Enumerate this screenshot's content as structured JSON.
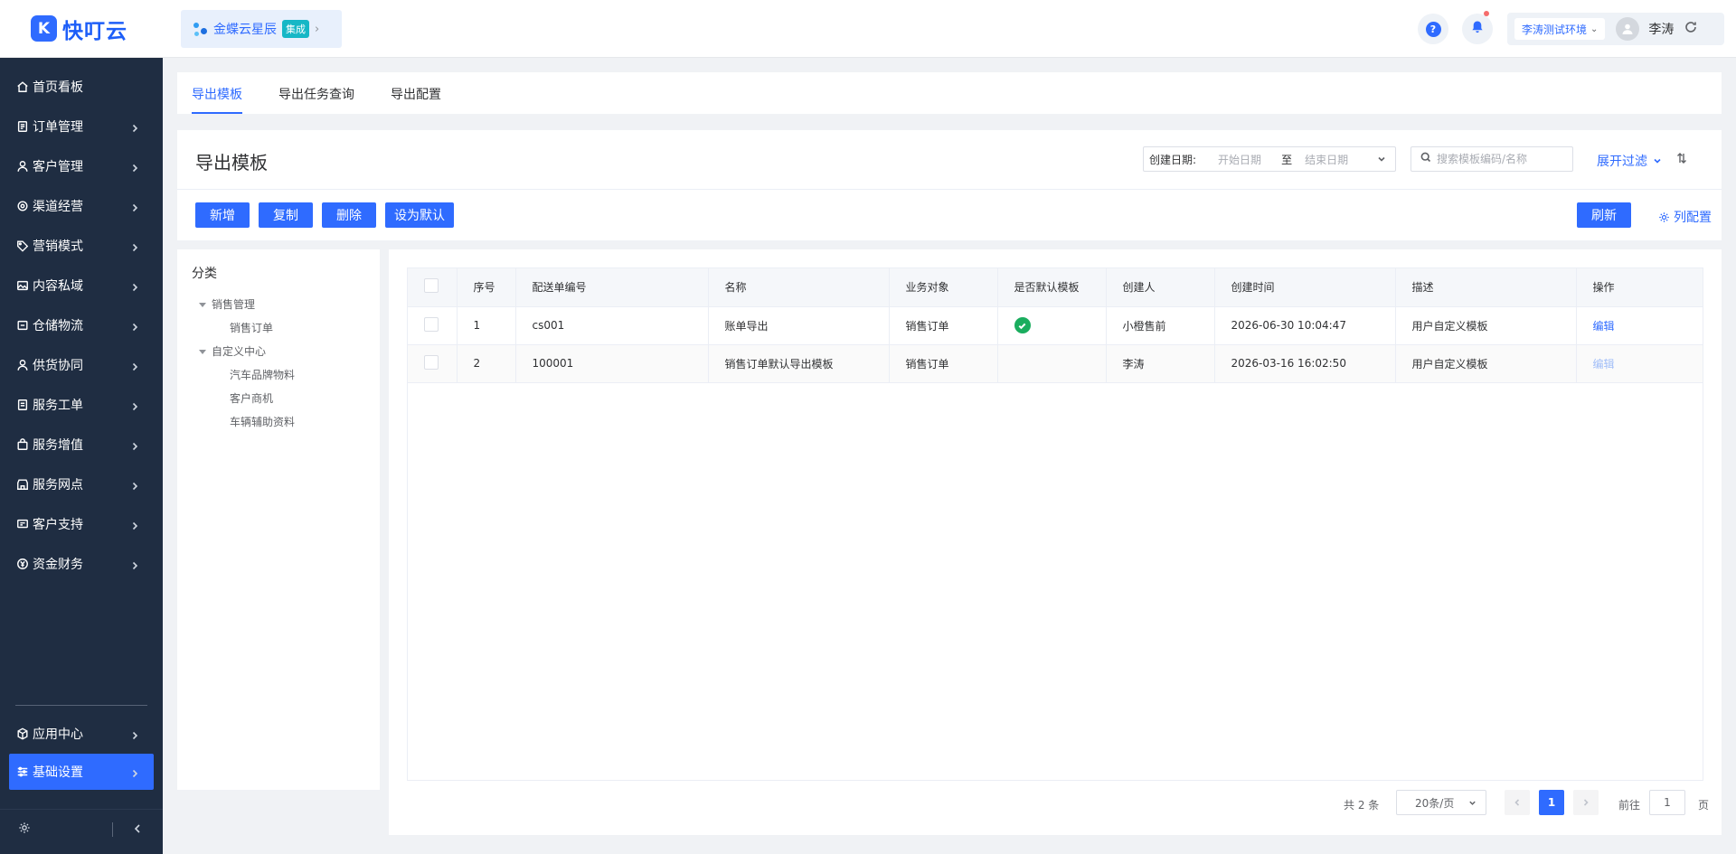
{
  "logo": {
    "text": "快叮云"
  },
  "sidebar": {
    "items": [
      {
        "label": "首页看板",
        "icon": "home-icon",
        "has_children": false
      },
      {
        "label": "订单管理",
        "icon": "order-icon",
        "has_children": true
      },
      {
        "label": "客户管理",
        "icon": "customer-icon",
        "has_children": true
      },
      {
        "label": "渠道经营",
        "icon": "channel-icon",
        "has_children": true
      },
      {
        "label": "营销模式",
        "icon": "tag-icon",
        "has_children": true
      },
      {
        "label": "内容私域",
        "icon": "image-icon",
        "has_children": true
      },
      {
        "label": "仓储物流",
        "icon": "warehouse-icon",
        "has_children": true
      },
      {
        "label": "供货协同",
        "icon": "supply-icon",
        "has_children": true
      },
      {
        "label": "服务工单",
        "icon": "ticket-icon",
        "has_children": true
      },
      {
        "label": "服务增值",
        "icon": "bag-icon",
        "has_children": true
      },
      {
        "label": "服务网点",
        "icon": "store-icon",
        "has_children": true
      },
      {
        "label": "客户支持",
        "icon": "support-icon",
        "has_children": true
      },
      {
        "label": "资金财务",
        "icon": "yen-icon",
        "has_children": true
      }
    ],
    "bottom_items": [
      {
        "label": "应用中心",
        "icon": "cube-icon",
        "active": false
      },
      {
        "label": "基础设置",
        "icon": "settings-sliders-icon",
        "active": true
      }
    ]
  },
  "header": {
    "integration": {
      "label": "金蝶云星辰",
      "badge": "集成"
    },
    "env": "李涛测试环境",
    "user_name": "李涛"
  },
  "tabs": [
    {
      "label": "导出模板",
      "active": true
    },
    {
      "label": "导出任务查询",
      "active": false
    },
    {
      "label": "导出配置",
      "active": false
    }
  ],
  "page": {
    "title": "导出模板",
    "filter": {
      "date_label": "创建日期:",
      "start_placeholder": "开始日期",
      "separator": "至",
      "end_placeholder": "结束日期",
      "search_placeholder": "搜索模板编码/名称",
      "expand_label": "展开过滤"
    },
    "actions": {
      "add": "新增",
      "copy": "复制",
      "delete": "删除",
      "set_default": "设为默认",
      "refresh": "刷新",
      "column_config": "列配置"
    }
  },
  "category": {
    "title": "分类",
    "groups": [
      {
        "label": "销售管理",
        "children": [
          "销售订单"
        ]
      },
      {
        "label": "自定义中心",
        "children": [
          "汽车品牌物料",
          "客户商机",
          "车辆辅助资料"
        ]
      }
    ]
  },
  "table": {
    "headers": [
      "序号",
      "配送单编号",
      "名称",
      "业务对象",
      "是否默认模板",
      "创建人",
      "创建时间",
      "描述",
      "操作"
    ],
    "rows": [
      {
        "index": "1",
        "code": "cs001",
        "name": "账单导出",
        "object": "销售订单",
        "is_default": true,
        "creator": "小橙售前",
        "created": "2026-06-30 10:04:47",
        "desc": "用户自定义模板",
        "action": "编辑"
      },
      {
        "index": "2",
        "code": "100001",
        "name": "销售订单默认导出模板",
        "object": "销售订单",
        "is_default": false,
        "creator": "李涛",
        "created": "2026-03-16 16:02:50",
        "desc": "用户自定义模板",
        "action": "编辑"
      }
    ]
  },
  "pagination": {
    "total": "共 2 条",
    "page_size": "20条/页",
    "current_page": "1",
    "goto_label": "前往",
    "goto_value": "1",
    "page_suffix": "页"
  },
  "colors": {
    "primary": "#2f6bff",
    "sidebar_bg": "#1f2d42",
    "success": "#1aad5e"
  }
}
